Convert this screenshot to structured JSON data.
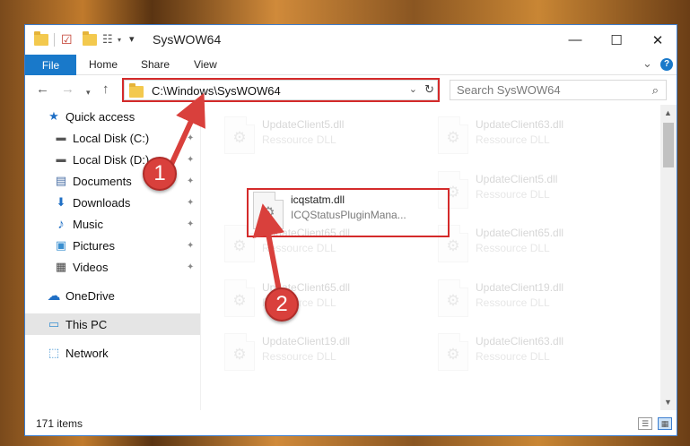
{
  "window": {
    "title": "SysWOW64",
    "minimize_glyph": "—",
    "maximize_glyph": "☐",
    "close_glyph": "✕"
  },
  "ribbon": {
    "tabs": [
      "File",
      "Home",
      "Share",
      "View"
    ],
    "collapse_glyph": "⌄",
    "help_glyph": "?"
  },
  "address_bar": {
    "path": "C:\\Windows\\SysWOW64",
    "dropdown_glyph": "⌄",
    "refresh_glyph": "↻"
  },
  "search": {
    "placeholder": "Search SysWOW64"
  },
  "nav_pane": {
    "items": [
      {
        "label": "Quick access",
        "icon": "star-icon",
        "glyph": "★",
        "color": "#1f6fc5",
        "pinned": false
      },
      {
        "label": "Local Disk (C:)",
        "icon": "drive-icon",
        "glyph": "▬",
        "color": "#555555",
        "pinned": true
      },
      {
        "label": "Local Disk (D:)",
        "icon": "drive-icon",
        "glyph": "▬",
        "color": "#555555",
        "pinned": true
      },
      {
        "label": "Documents",
        "icon": "documents-icon",
        "glyph": "▤",
        "color": "#4a6fa5",
        "pinned": true
      },
      {
        "label": "Downloads",
        "icon": "download-icon",
        "glyph": "⬇",
        "color": "#1f6fc5",
        "pinned": true
      },
      {
        "label": "Music",
        "icon": "music-icon",
        "glyph": "♪",
        "color": "#1f6fc5",
        "pinned": true
      },
      {
        "label": "Pictures",
        "icon": "pictures-icon",
        "glyph": "▣",
        "color": "#3a8fd0",
        "pinned": true
      },
      {
        "label": "Videos",
        "icon": "videos-icon",
        "glyph": "▦",
        "color": "#444444",
        "pinned": true
      },
      {
        "label": "OneDrive",
        "icon": "cloud-icon",
        "glyph": "☁",
        "color": "#1f6fc5",
        "pinned": false
      },
      {
        "label": "This PC",
        "icon": "computer-icon",
        "glyph": "▭",
        "color": "#3a8fd0",
        "pinned": false,
        "selected": true
      },
      {
        "label": "Network",
        "icon": "network-icon",
        "glyph": "⬚",
        "color": "#3a8fd0",
        "pinned": false
      }
    ],
    "pin_glyph": "📌"
  },
  "files": {
    "highlighted": {
      "name": "icqstatm.dll",
      "type": "ICQStatusPluginMana..."
    },
    "background": [
      {
        "name": "UpdateClient5.dll",
        "type": "Ressource DLL"
      },
      {
        "name": "UpdateClient63.dll",
        "type": "Ressource DLL"
      },
      {
        "name": "UpdateClient5.dll",
        "type": "Ressource DLL"
      },
      {
        "name": "UpdateClient65.dll",
        "type": "Ressource DLL"
      },
      {
        "name": "UpdateClient65.dll",
        "type": "Ressource DLL"
      },
      {
        "name": "UpdateClient65.dll",
        "type": "Ressource DLL"
      },
      {
        "name": "UpdateClient19.dll",
        "type": "Ressource DLL"
      },
      {
        "name": "UpdateClient19.dll",
        "type": "Ressource DLL"
      },
      {
        "name": "UpdateClient63.dll",
        "type": "Ressource DLL"
      }
    ]
  },
  "status_bar": {
    "item_count": "171 items"
  },
  "annotations": {
    "step1": "1",
    "step2": "2",
    "color": "#d9403c"
  }
}
